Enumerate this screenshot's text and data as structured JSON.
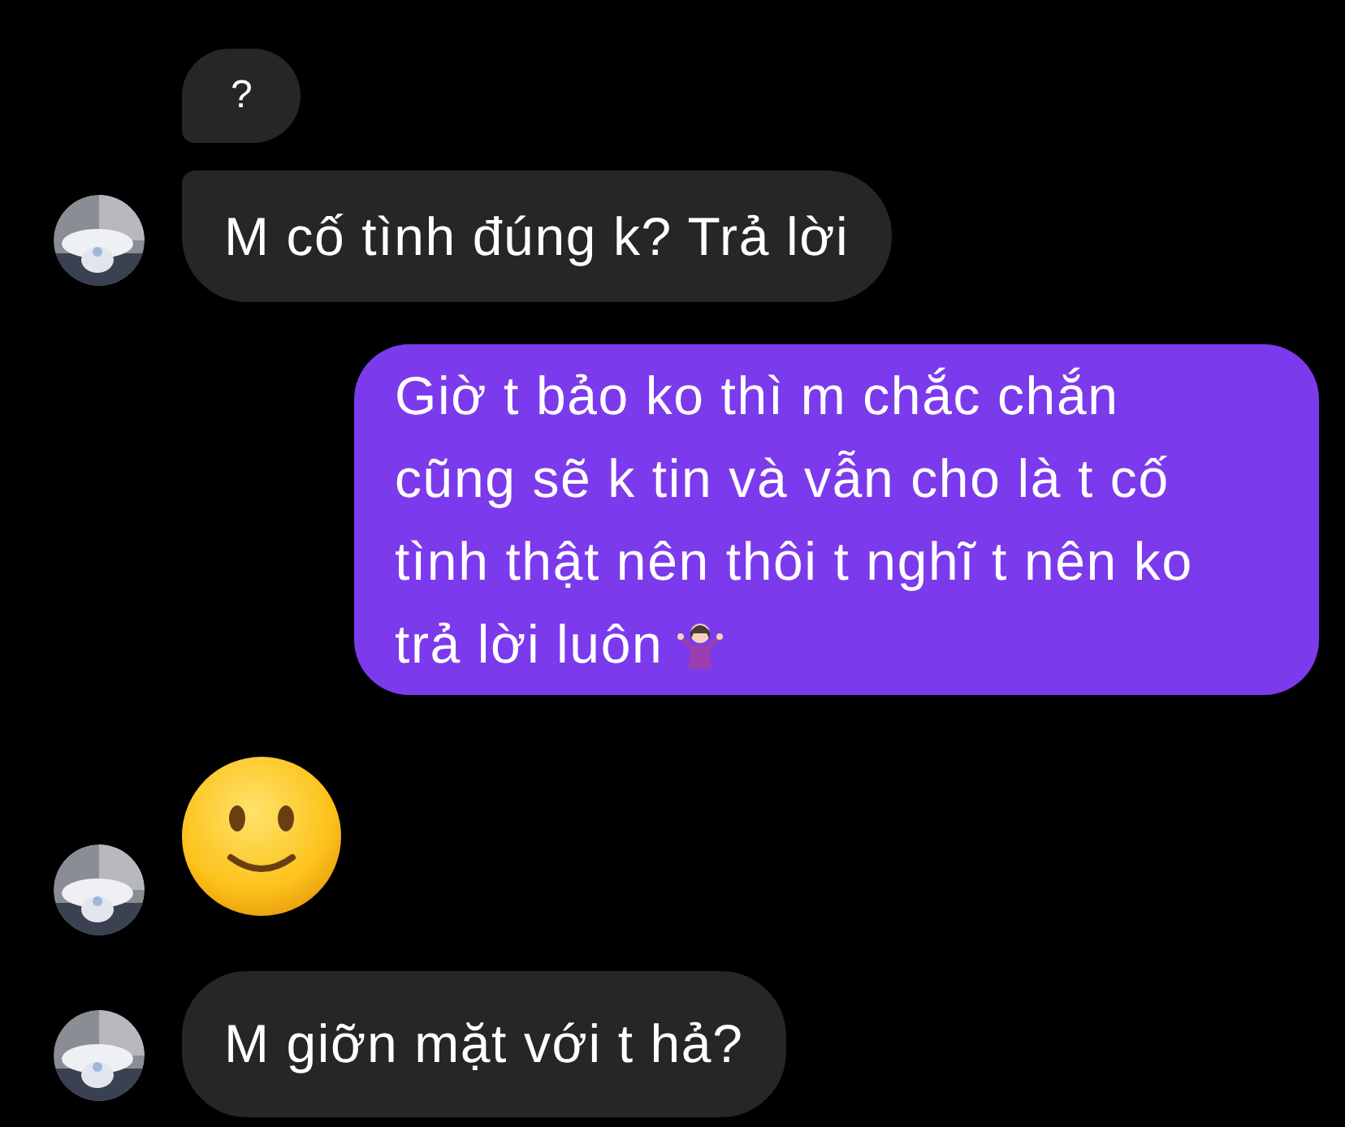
{
  "messages": [
    {
      "kind": "text",
      "outgoing": false,
      "show_avatar": false,
      "text": "?"
    },
    {
      "kind": "text",
      "outgoing": false,
      "show_avatar": true,
      "text": "M cố tình đúng k? Trả lời"
    },
    {
      "kind": "text",
      "outgoing": true,
      "text": "Giờ t bảo ko thì m chắc chắn cũng sẽ k tin và vẫn cho là t cố tình thật nên thôi t nghĩ t nên ko trả lời luôn",
      "trailing_emoji": true
    },
    {
      "kind": "emoji",
      "outgoing": false,
      "show_avatar": true
    },
    {
      "kind": "text",
      "outgoing": false,
      "show_avatar": true,
      "text": "M giỡn mặt với t hả?"
    }
  ]
}
